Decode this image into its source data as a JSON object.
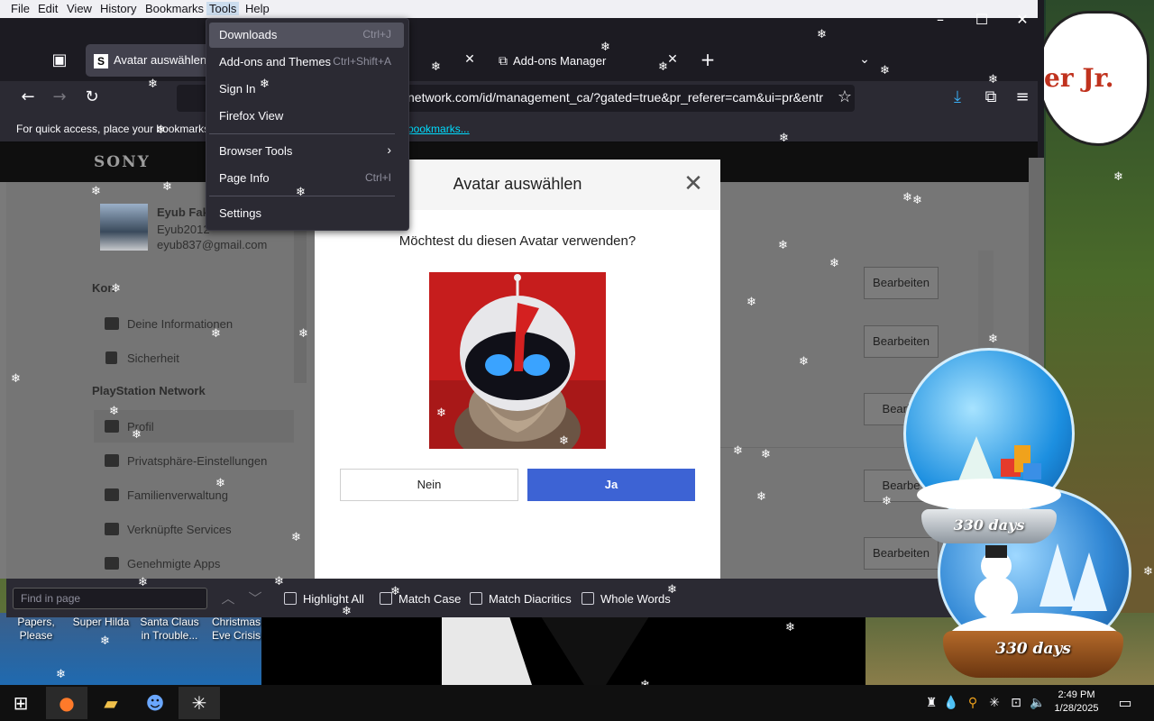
{
  "menubar": {
    "items": [
      "File",
      "Edit",
      "View",
      "History",
      "Bookmarks",
      "Tools",
      "Help"
    ],
    "active": "Tools"
  },
  "tabs": [
    {
      "label": "Avatar auswählen |",
      "icon": "sony-s-icon"
    },
    {
      "label": "Add-ons Manager",
      "icon": "puzzle-icon"
    }
  ],
  "toolbar": {
    "url": "network.com/id/management_ca/?gated=true&pr_referer=cam&ui=pr&entr"
  },
  "bookmarks_bar": {
    "text": "For quick access, place your bookmarks",
    "link": "bookmarks..."
  },
  "tools_menu": {
    "items": [
      {
        "label": "Downloads",
        "shortcut": "Ctrl+J"
      },
      {
        "label": "Add-ons and Themes",
        "shortcut": "Ctrl+Shift+A"
      },
      {
        "label": "Sign In",
        "shortcut": ""
      },
      {
        "label": "Firefox View",
        "shortcut": ""
      },
      {
        "label": "Browser Tools",
        "shortcut": ""
      },
      {
        "label": "Page Info",
        "shortcut": "Ctrl+I"
      },
      {
        "label": "Settings",
        "shortcut": ""
      }
    ]
  },
  "page": {
    "brand": "SONY",
    "user": {
      "name": "Eyub Faki",
      "id": "Eyub2012",
      "email": "eyub837@gmail.com"
    },
    "sidebar": {
      "section1": "Kon",
      "items1": [
        "Deine Informationen",
        "Sicherheit"
      ],
      "section2": "PlayStation Network",
      "items2": [
        "Profil",
        "Privatsphäre-Einstellungen",
        "Familienverwaltung",
        "Verknüpfte Services",
        "Genehmigte Apps"
      ]
    },
    "edit_label": "Bearbeiten",
    "edit_label_partial": "Bearbe"
  },
  "modal": {
    "title": "Avatar auswählen",
    "question": "Möchtest du diesen Avatar verwenden?",
    "no_label": "Nein",
    "yes_label": "Ja"
  },
  "findbar": {
    "placeholder": "Find in page",
    "options": [
      "Highlight All",
      "Match Case",
      "Match Diacritics",
      "Whole Words"
    ]
  },
  "desktop": {
    "icons": [
      {
        "label": "Papers,\nPlease"
      },
      {
        "label": "Super Hilda"
      },
      {
        "label": "Santa Claus\nin Trouble..."
      },
      {
        "label": "Christmas\nEve Crisis"
      }
    ],
    "bubble_text": "er Jr.",
    "globe1_days": "330 days",
    "globe2_days": "330 days"
  },
  "taskbar": {
    "time": "2:49 PM",
    "date": "1/28/2025"
  },
  "colors": {
    "accent_blue": "#3d63d4",
    "toolbar": "#2b2a33",
    "menu_hover": "#52525e"
  }
}
